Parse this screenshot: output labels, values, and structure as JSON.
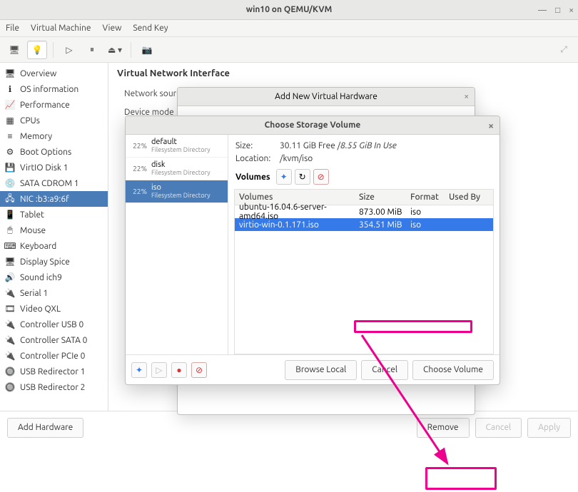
{
  "window": {
    "title": "win10 on QEMU/KVM"
  },
  "menubar": [
    "File",
    "Virtual Machine",
    "View",
    "Send Key"
  ],
  "sidebar": {
    "items": [
      {
        "label": "Overview"
      },
      {
        "label": "OS information"
      },
      {
        "label": "Performance"
      },
      {
        "label": "CPUs"
      },
      {
        "label": "Memory"
      },
      {
        "label": "Boot Options"
      },
      {
        "label": "VirtIO Disk 1"
      },
      {
        "label": "SATA CDROM 1"
      },
      {
        "label": "NIC :b3:a9:6f"
      },
      {
        "label": "Tablet"
      },
      {
        "label": "Mouse"
      },
      {
        "label": "Keyboard"
      },
      {
        "label": "Display Spice"
      },
      {
        "label": "Sound ich9"
      },
      {
        "label": "Serial 1"
      },
      {
        "label": "Video QXL"
      },
      {
        "label": "Controller USB 0"
      },
      {
        "label": "Controller SATA 0"
      },
      {
        "label": "Controller PCIe 0"
      },
      {
        "label": "USB Redirector 1"
      },
      {
        "label": "USB Redirector 2"
      }
    ],
    "selected_index": 8
  },
  "detail": {
    "heading": "Virtual Network Interface",
    "rows": [
      {
        "label": "Network source:"
      },
      {
        "label": "Device mode"
      }
    ]
  },
  "footer": {
    "add_hw": "Add Hardware",
    "remove": "Remove",
    "cancel": "Cancel",
    "apply": "Apply"
  },
  "dlg_add": {
    "title": "Add New Virtual Hardware"
  },
  "dlg_vol": {
    "title": "Choose Storage Volume",
    "size_label": "Size:",
    "size_value": "30.11 GiB Free / ",
    "size_used": "8.55 GiB In Use",
    "location_label": "Location:",
    "location_value": "/kvm/iso",
    "volumes_label": "Volumes",
    "pools": [
      {
        "pct": "22%",
        "name": "default",
        "sub": "Filesystem Directory"
      },
      {
        "pct": "22%",
        "name": "disk",
        "sub": "Filesystem Directory"
      },
      {
        "pct": "22%",
        "name": "iso",
        "sub": "Filesystem Directory"
      }
    ],
    "pool_selected": 2,
    "columns": [
      "Volumes",
      "Size",
      "Format",
      "Used By"
    ],
    "rows": [
      {
        "name": "ubuntu-16.04.6-server-amd64.iso",
        "size": "873.00 MiB",
        "fmt": "iso",
        "used": ""
      },
      {
        "name": "virtio-win-0.1.171.iso",
        "size": "354.51 MiB",
        "fmt": "iso",
        "used": ""
      }
    ],
    "row_selected": 1,
    "browse": "Browse Local",
    "cancel": "Cancel",
    "choose": "Choose Volume"
  }
}
